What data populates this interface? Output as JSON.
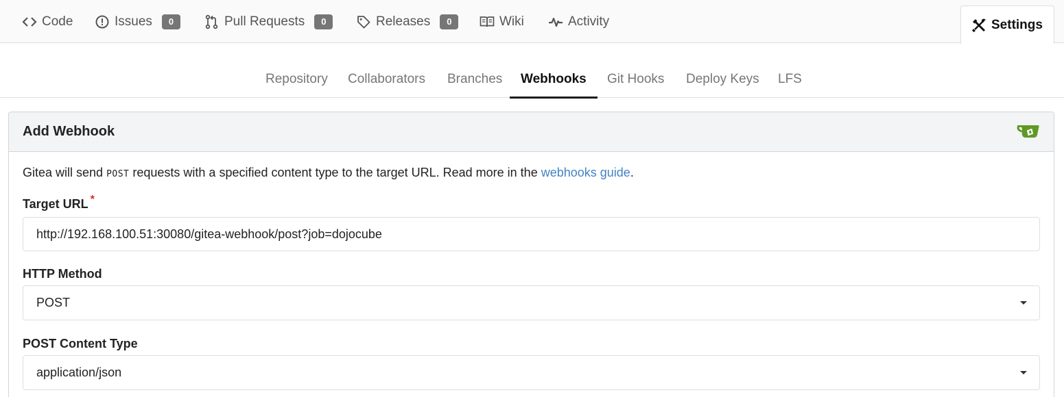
{
  "repo_tabs": [
    {
      "label": "Code",
      "icon": "code-icon"
    },
    {
      "label": "Issues",
      "icon": "issue-icon",
      "count": "0"
    },
    {
      "label": "Pull Requests",
      "icon": "pull-request-icon",
      "count": "0"
    },
    {
      "label": "Releases",
      "icon": "tag-icon",
      "count": "0"
    },
    {
      "label": "Wiki",
      "icon": "book-icon"
    },
    {
      "label": "Activity",
      "icon": "pulse-icon"
    },
    {
      "label": "Settings",
      "icon": "tools-icon",
      "active": true
    }
  ],
  "settings_menu": [
    {
      "label": "Repository"
    },
    {
      "label": "Collaborators"
    },
    {
      "label": "Branches"
    },
    {
      "label": "Webhooks",
      "active": true
    },
    {
      "label": "Git Hooks"
    },
    {
      "label": "Deploy Keys"
    },
    {
      "label": "LFS"
    }
  ],
  "form": {
    "title": "Add Webhook",
    "logo": "gitea-logo",
    "intro_before": "Gitea will send ",
    "intro_method": "POST",
    "intro_middle": " requests with a specified content type to the target URL. Read more in the ",
    "intro_link": "webhooks guide",
    "intro_after": ".",
    "target_url_label": "Target URL",
    "required_mark": "*",
    "target_url_value": "http://192.168.100.51:30080/gitea-webhook/post?job=dojocube",
    "http_method_label": "HTTP Method",
    "http_method_value": "POST",
    "content_type_label": "POST Content Type",
    "content_type_value": "application/json"
  },
  "colors": {
    "link": "#4183c4",
    "badge": "#767676",
    "required": "#db2828",
    "gitea_green": "#609926"
  }
}
